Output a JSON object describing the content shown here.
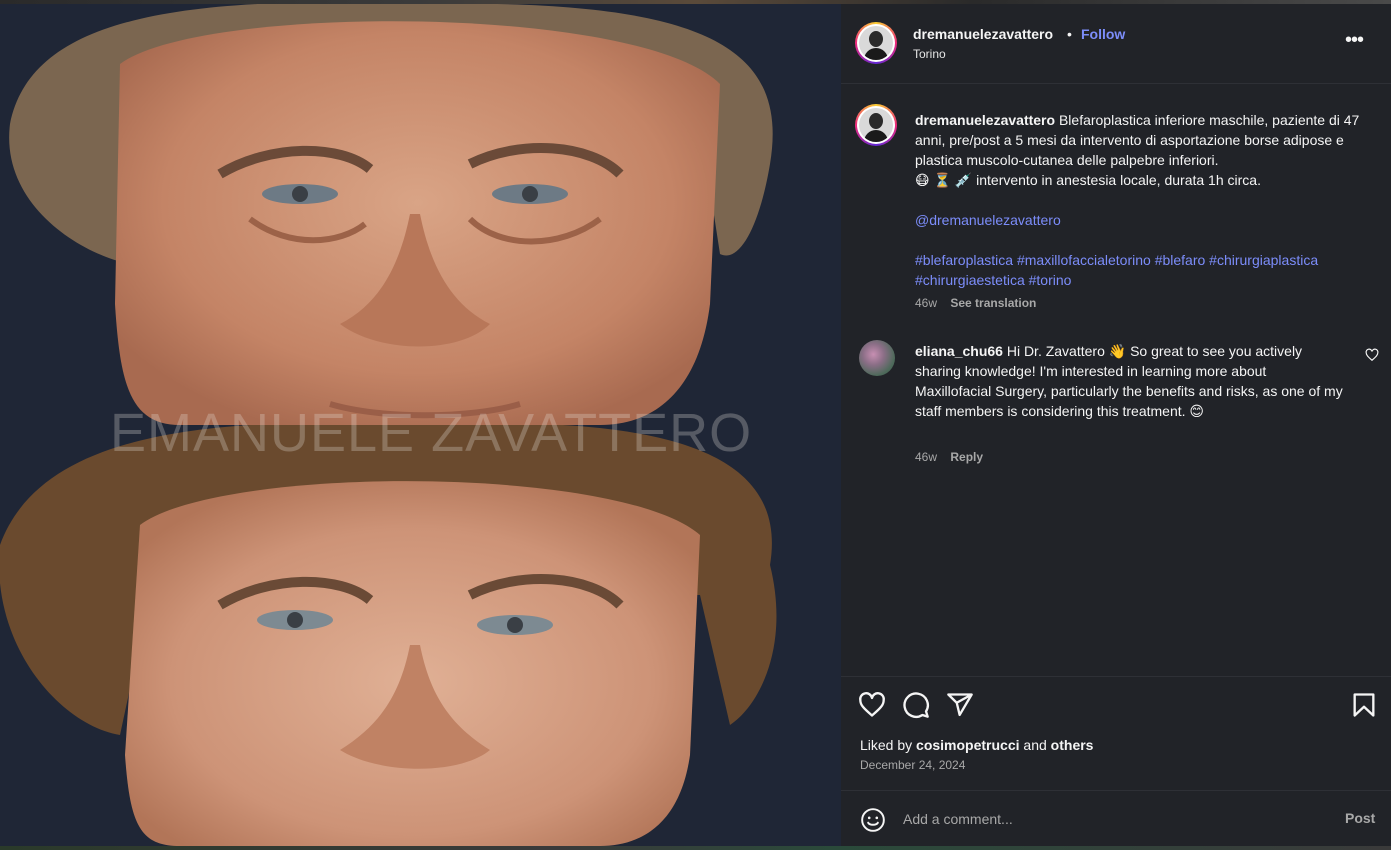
{
  "post": {
    "username": "dremanuelezavattero",
    "separator": "•",
    "follow_label": "Follow",
    "location": "Torino",
    "more_label": "•••",
    "watermark": "EMANUELE ZAVATTERO"
  },
  "caption": {
    "username": "dremanuelezavattero",
    "text": "Blefaroplastica inferiore maschile, paziente di 47 anni, pre/post a 5 mesi da intervento di asportazione borse adipose e plastica muscolo-cutanea delle palpebre inferiori.",
    "emoji_line": "😷 ⏳ 💉 intervento in anestesia locale, durata 1h circa.",
    "mention": "@dremanuelezavattero",
    "hashtags": [
      "#blefaroplastica",
      "#maxillofaccialetorino",
      "#blefaro",
      "#chirurgiaplastica",
      "#chirurgiaestetica",
      "#torino"
    ],
    "age": "46w",
    "see_translation": "See translation"
  },
  "comments": [
    {
      "username": "eliana_chu66",
      "text": "Hi Dr. Zavattero 👋 So great to see you actively sharing knowledge! I'm interested in learning more about Maxillofacial Surgery, particularly the benefits and risks, as one of my staff members is considering this treatment. 😊",
      "age": "46w",
      "reply_label": "Reply"
    }
  ],
  "likes": {
    "prefix": "Liked by",
    "user": "cosimopetrucci",
    "conj": "and",
    "others": "others"
  },
  "date": "December 24, 2024",
  "add_comment": {
    "placeholder": "Add a comment...",
    "post_label": "Post"
  },
  "icons": [
    "heart-icon",
    "comment-icon",
    "share-icon",
    "bookmark-icon",
    "emoji-icon",
    "more-icon"
  ]
}
